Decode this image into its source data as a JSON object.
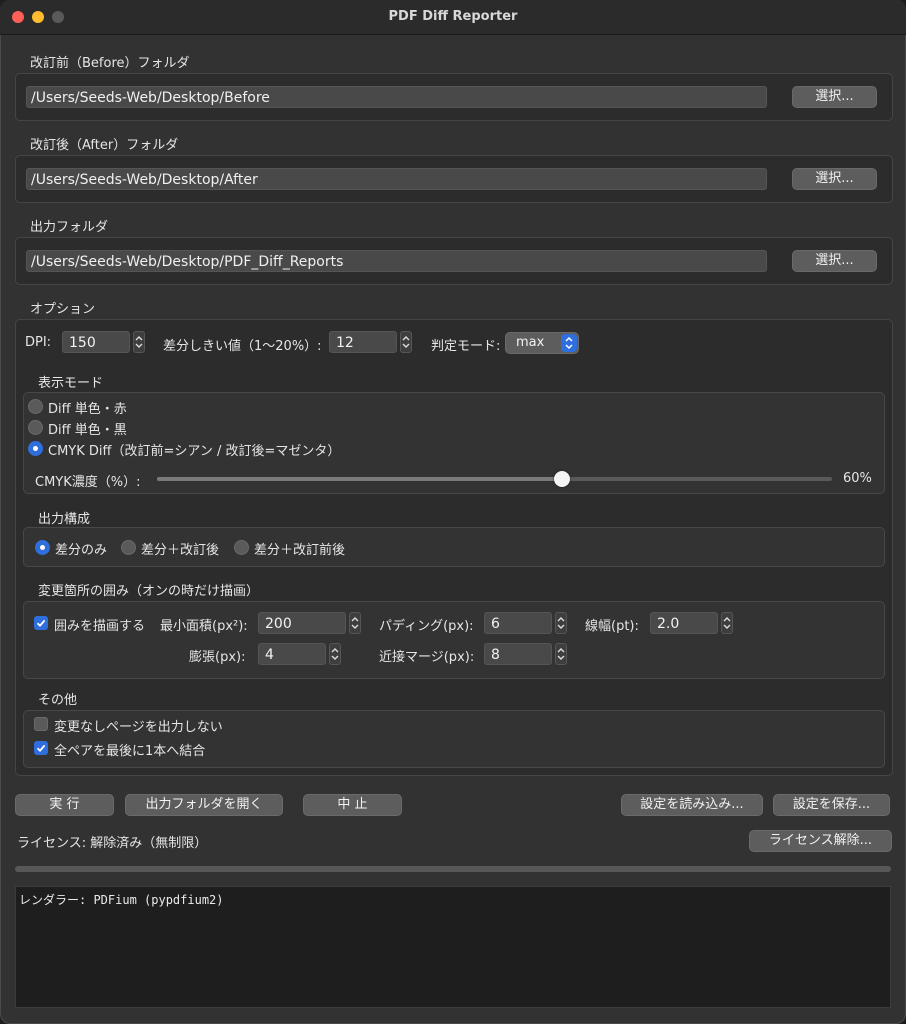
{
  "window": {
    "title": "PDF Diff Reporter"
  },
  "before": {
    "label": "改訂前（Before）フォルダ",
    "path": "/Users/Seeds-Web/Desktop/Before",
    "button": "選択..."
  },
  "after": {
    "label": "改訂後（After）フォルダ",
    "path": "/Users/Seeds-Web/Desktop/After",
    "button": "選択..."
  },
  "output": {
    "label": "出力フォルダ",
    "path": "/Users/Seeds-Web/Desktop/PDF_Diff_Reports",
    "button": "選択..."
  },
  "options": {
    "label": "オプション",
    "dpi_label": "DPI:",
    "dpi_value": "150",
    "threshold_label": "差分しきい値（1〜20%）:",
    "threshold_value": "12",
    "judge_label": "判定モード:",
    "judge_value": "max"
  },
  "display_mode": {
    "label": "表示モード",
    "radios": [
      {
        "label": "Diff 単色・赤",
        "checked": false
      },
      {
        "label": "Diff 単色・黒",
        "checked": false
      },
      {
        "label": "CMYK Diff（改訂前=シアン / 改訂後=マゼンタ）",
        "checked": true
      }
    ],
    "cmyk_label": "CMYK濃度（%）:",
    "cmyk_value": 60,
    "cmyk_display": "60%"
  },
  "output_config": {
    "label": "出力構成",
    "radios": [
      {
        "label": "差分のみ",
        "checked": true
      },
      {
        "label": "差分＋改訂後",
        "checked": false
      },
      {
        "label": "差分＋改訂前後",
        "checked": false
      }
    ]
  },
  "box": {
    "label": "変更箇所の囲み（オンの時だけ描画）",
    "draw_label": "囲みを描画する",
    "draw_checked": true,
    "min_area_label": "最小面積(px²):",
    "min_area_value": "200",
    "padding_label": "パディング(px):",
    "padding_value": "6",
    "line_label": "線幅(pt):",
    "line_value": "2.0",
    "dilate_label": "膨張(px):",
    "dilate_value": "4",
    "merge_label": "近接マージ(px):",
    "merge_value": "8"
  },
  "other": {
    "label": "その他",
    "skip_label": "変更なしページを出力しない",
    "skip_checked": false,
    "merge_label": "全ペアを最後に1本へ結合",
    "merge_checked": true
  },
  "buttons": {
    "run": "実 行",
    "open_output": "出力フォルダを開く",
    "stop": "中 止",
    "load": "設定を読み込み...",
    "save": "設定を保存..."
  },
  "license": {
    "status": "ライセンス: 解除済み（無制限）",
    "button": "ライセンス解除..."
  },
  "progress": 0,
  "log": "レンダラー: PDFium (pypdfium2)",
  "colors": {
    "accent": "#2f6fdd",
    "window_bg": "#323232",
    "close": "#fe5f57",
    "minimize": "#febc2e"
  }
}
